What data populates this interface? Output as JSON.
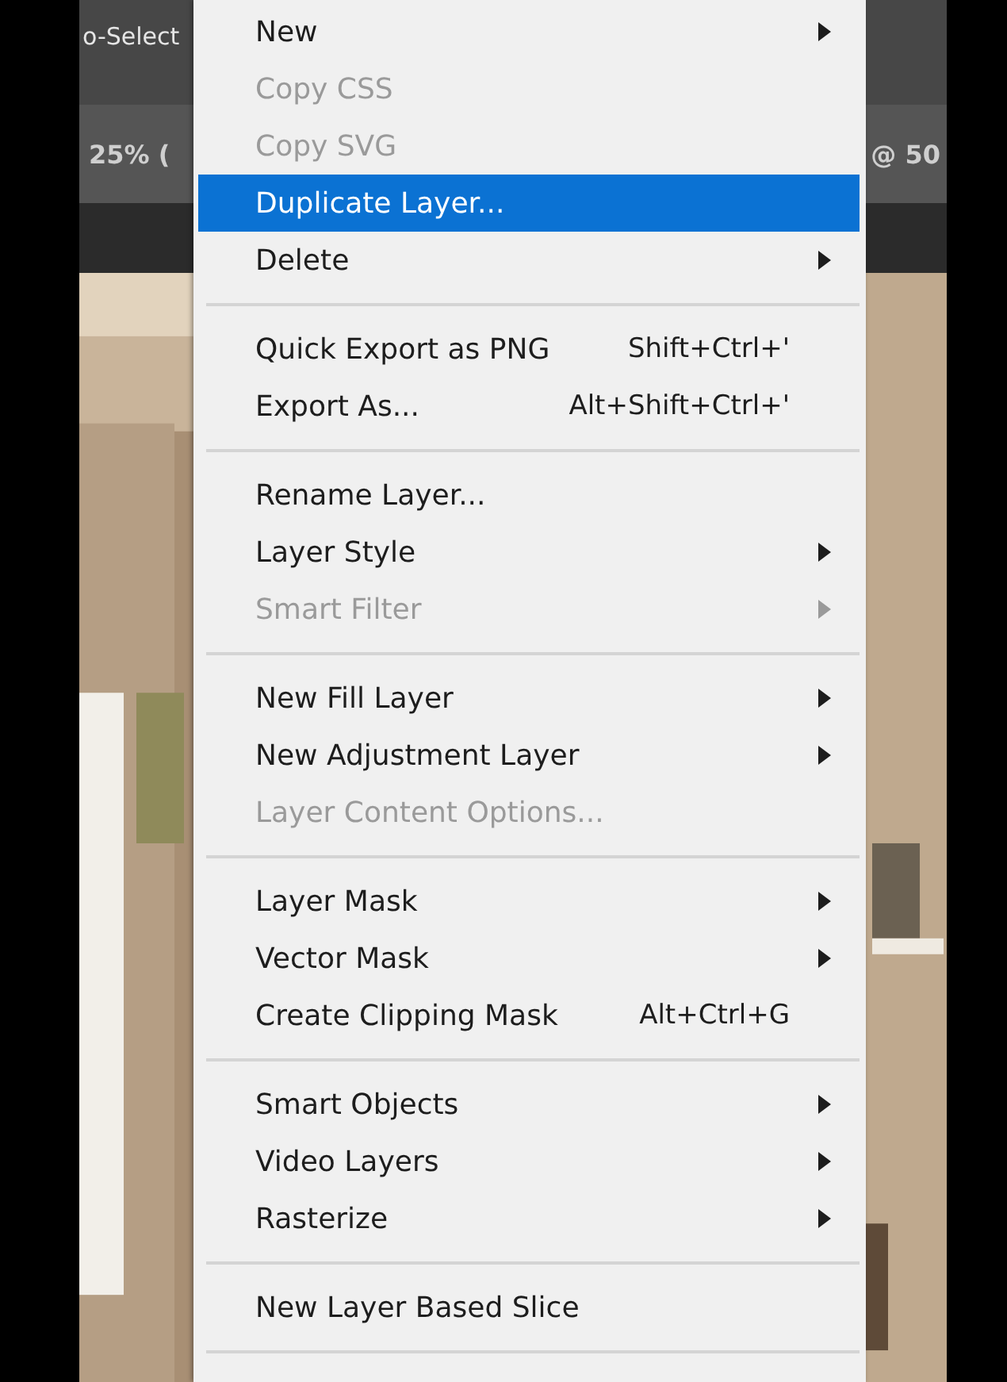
{
  "options_bar": {
    "text": "o-Select"
  },
  "document_tabs": [
    {
      "label": "25% ("
    },
    {
      "label": "@ 50"
    }
  ],
  "context_menu": {
    "items": [
      {
        "kind": "item",
        "label": "New",
        "submenu": true,
        "disabled": false,
        "selected": false
      },
      {
        "kind": "item",
        "label": "Copy CSS",
        "submenu": false,
        "disabled": true,
        "selected": false
      },
      {
        "kind": "item",
        "label": "Copy SVG",
        "submenu": false,
        "disabled": true,
        "selected": false
      },
      {
        "kind": "item",
        "label": "Duplicate Layer...",
        "submenu": false,
        "disabled": false,
        "selected": true
      },
      {
        "kind": "item",
        "label": "Delete",
        "submenu": true,
        "disabled": false,
        "selected": false
      },
      {
        "kind": "separator"
      },
      {
        "kind": "item",
        "label": "Quick Export as PNG",
        "shortcut": "Shift+Ctrl+'",
        "submenu": false,
        "disabled": false,
        "selected": false
      },
      {
        "kind": "item",
        "label": "Export As...",
        "shortcut": "Alt+Shift+Ctrl+'",
        "submenu": false,
        "disabled": false,
        "selected": false
      },
      {
        "kind": "separator"
      },
      {
        "kind": "item",
        "label": "Rename Layer...",
        "submenu": false,
        "disabled": false,
        "selected": false
      },
      {
        "kind": "item",
        "label": "Layer Style",
        "submenu": true,
        "disabled": false,
        "selected": false
      },
      {
        "kind": "item",
        "label": "Smart Filter",
        "submenu": true,
        "disabled": true,
        "selected": false
      },
      {
        "kind": "separator"
      },
      {
        "kind": "item",
        "label": "New Fill Layer",
        "submenu": true,
        "disabled": false,
        "selected": false
      },
      {
        "kind": "item",
        "label": "New Adjustment Layer",
        "submenu": true,
        "disabled": false,
        "selected": false
      },
      {
        "kind": "item",
        "label": "Layer Content Options...",
        "submenu": false,
        "disabled": true,
        "selected": false
      },
      {
        "kind": "separator"
      },
      {
        "kind": "item",
        "label": "Layer Mask",
        "submenu": true,
        "disabled": false,
        "selected": false
      },
      {
        "kind": "item",
        "label": "Vector Mask",
        "submenu": true,
        "disabled": false,
        "selected": false
      },
      {
        "kind": "item",
        "label": "Create Clipping Mask",
        "shortcut": "Alt+Ctrl+G",
        "submenu": false,
        "disabled": false,
        "selected": false
      },
      {
        "kind": "separator"
      },
      {
        "kind": "item",
        "label": "Smart Objects",
        "submenu": true,
        "disabled": false,
        "selected": false
      },
      {
        "kind": "item",
        "label": "Video Layers",
        "submenu": true,
        "disabled": false,
        "selected": false
      },
      {
        "kind": "item",
        "label": "Rasterize",
        "submenu": true,
        "disabled": false,
        "selected": false
      },
      {
        "kind": "separator"
      },
      {
        "kind": "item",
        "label": "New Layer Based Slice",
        "submenu": false,
        "disabled": false,
        "selected": false
      },
      {
        "kind": "separator"
      }
    ]
  }
}
